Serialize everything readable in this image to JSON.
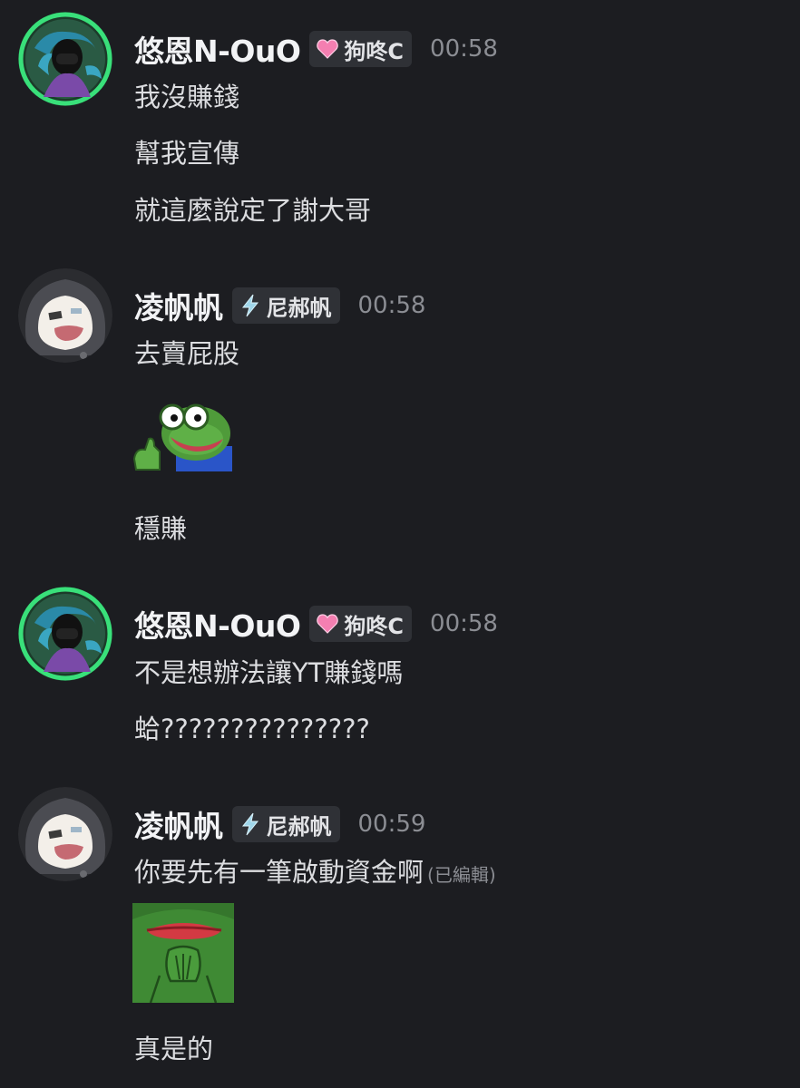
{
  "colors": {
    "background": "#1c1d21",
    "text": "#dcdde0",
    "username": "#f2f3f5",
    "timestamp": "#8b8d93",
    "tag_bg": "#2f3136",
    "heart": "#f47fb1",
    "bolt": "#9fd6ea"
  },
  "messages": [
    {
      "author": "悠恩N-OuO",
      "tag": "狗咚C",
      "tag_icon": "heart-icon",
      "time": "00:58",
      "lines": [
        "我沒賺錢",
        "幫我宣傳",
        "就這麼說定了謝大哥"
      ]
    },
    {
      "author": "凌帆帆",
      "tag": "尼郝帆",
      "tag_icon": "lightning-bolt-icon",
      "time": "00:58",
      "lines": [
        "去賣屁股",
        "穩賺"
      ],
      "sticker": "pepe-thumbs-up-sticker"
    },
    {
      "author": "悠恩N-OuO",
      "tag": "狗咚C",
      "tag_icon": "heart-icon",
      "time": "00:58",
      "lines": [
        "不是想辦法讓YT賺錢嗎",
        "蛤???????????????"
      ]
    },
    {
      "author": "凌帆帆",
      "tag": "尼郝帆",
      "tag_icon": "lightning-bolt-icon",
      "time": "00:59",
      "lines": [
        "你要先有一筆啟動資金啊",
        "真是的"
      ],
      "edited_label": "(已編輯)",
      "sticker": "pepe-hands-together-sticker"
    }
  ]
}
